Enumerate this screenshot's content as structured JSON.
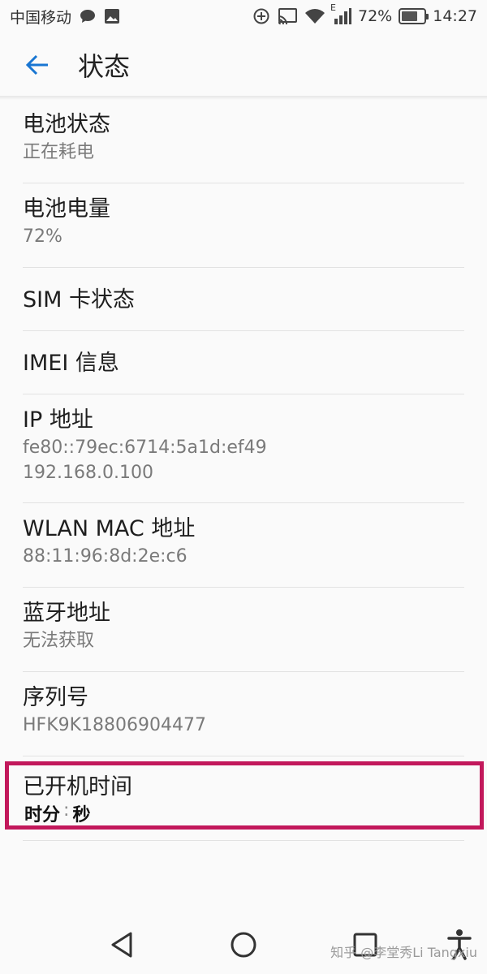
{
  "status_bar": {
    "carrier": "中国移动",
    "battery_percent": "72%",
    "battery_level": 0.72,
    "time": "14:27",
    "icons": [
      "chat-bubble-icon",
      "image-icon",
      "add-circle-icon",
      "cast-icon",
      "wifi-icon",
      "signal-icon",
      "battery-icon"
    ],
    "network_type": "E"
  },
  "app_bar": {
    "title": "状态",
    "back_icon": "arrow-back-icon"
  },
  "items": [
    {
      "title": "电池状态",
      "sub": [
        "正在耗电"
      ]
    },
    {
      "title": "电池电量",
      "sub": [
        "72%"
      ]
    },
    {
      "title": "SIM 卡状态",
      "sub": []
    },
    {
      "title": "IMEI 信息",
      "sub": []
    },
    {
      "title": "IP 地址",
      "sub": [
        "fe80::79ec:6714:5a1d:ef49",
        "192.168.0.100"
      ]
    },
    {
      "title": "WLAN MAC 地址",
      "sub": [
        "88:11:96:8d:2e:c6"
      ]
    },
    {
      "title": "蓝牙地址",
      "sub": [
        "无法获取"
      ]
    },
    {
      "title": "序列号",
      "sub": [
        "HFK9K18806904477"
      ]
    },
    {
      "title": "已开机时间",
      "sub": []
    }
  ],
  "uptime": {
    "hour_label": "时",
    "minute_label": "分",
    "second_label": "秒",
    "separator": ":"
  },
  "nav_bar": {
    "back": "triangle-back-icon",
    "home": "circle-home-icon",
    "recents": "square-recents-icon",
    "accessibility": "accessibility-icon"
  },
  "watermark": "知乎 @李堂秀Li Tangxiu",
  "colors": {
    "accent": "#1976d2",
    "highlight": "#c2185b"
  }
}
